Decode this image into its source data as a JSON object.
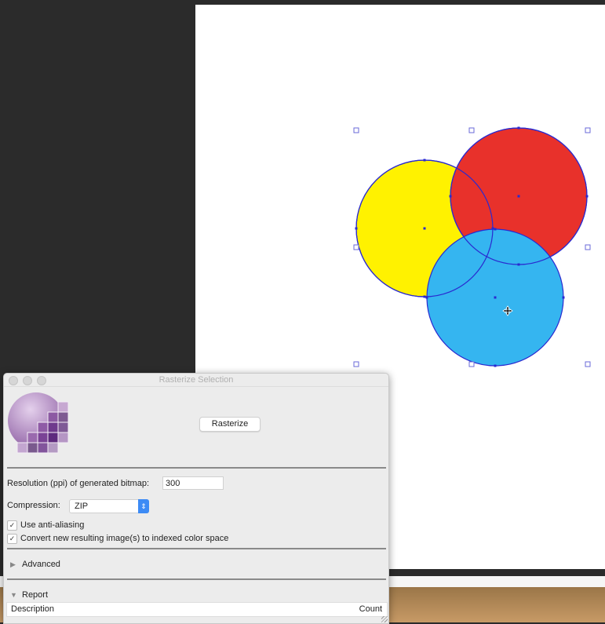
{
  "canvas": {
    "shapes": [
      {
        "name": "yellow-circle",
        "color": "#fff200"
      },
      {
        "name": "red-circle",
        "color": "#e8312b"
      },
      {
        "name": "blue-circle",
        "color": "#35b5f0"
      }
    ],
    "selection_color": "#2a2ad0",
    "cursor_icon": "move-cursor-icon"
  },
  "dialog": {
    "title": "Rasterize Selection",
    "rasterize_label": "Rasterize",
    "resolution_label": "Resolution (ppi) of generated bitmap:",
    "resolution_value": "300",
    "compression_label": "Compression:",
    "compression_value": "ZIP",
    "anti_aliasing_label": "Use anti-aliasing",
    "anti_aliasing_checked": true,
    "indexed_label": "Convert new resulting image(s) to indexed color space",
    "indexed_checked": true,
    "advanced_label": "Advanced",
    "report_label": "Report",
    "table_headers": [
      "Description",
      "Count"
    ],
    "check_glyph": "✓"
  }
}
